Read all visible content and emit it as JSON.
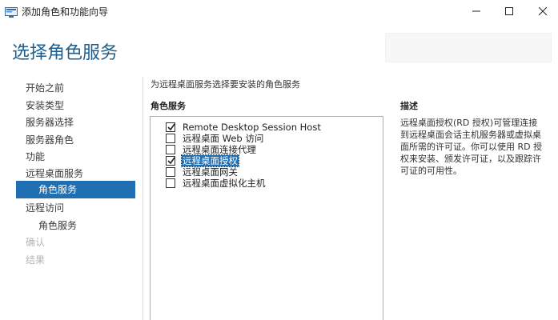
{
  "window": {
    "title": "添加角色和功能向导",
    "min_glyph": "—",
    "max_glyph": "☐",
    "close_glyph": "✕"
  },
  "header": {
    "page_title": "选择角色服务"
  },
  "nav": {
    "items": [
      {
        "label": "开始之前",
        "state": "normal"
      },
      {
        "label": "安装类型",
        "state": "normal"
      },
      {
        "label": "服务器选择",
        "state": "normal"
      },
      {
        "label": "服务器角色",
        "state": "normal"
      },
      {
        "label": "功能",
        "state": "normal"
      },
      {
        "label": "远程桌面服务",
        "state": "normal"
      },
      {
        "label": "角色服务",
        "state": "selected"
      },
      {
        "label": "远程访问",
        "state": "normal"
      },
      {
        "label": "角色服务",
        "state": "normal"
      },
      {
        "label": "确认",
        "state": "disabled"
      },
      {
        "label": "结果",
        "state": "disabled"
      }
    ]
  },
  "main": {
    "instruction": "为远程桌面服务选择要安装的角色服务",
    "roles_header": "角色服务",
    "roles": [
      {
        "label": "Remote Desktop Session Host",
        "checked": true,
        "selected": false
      },
      {
        "label": "远程桌面 Web 访问",
        "checked": false,
        "selected": false
      },
      {
        "label": "远程桌面连接代理",
        "checked": false,
        "selected": false
      },
      {
        "label": "远程桌面授权",
        "checked": true,
        "selected": true
      },
      {
        "label": "远程桌面网关",
        "checked": false,
        "selected": false
      },
      {
        "label": "远程桌面虚拟化主机",
        "checked": false,
        "selected": false
      }
    ],
    "description_header": "描述",
    "description": "远程桌面授权(RD 授权)可管理连接到远程桌面会话主机服务器或虚拟桌面所需的许可证。你可以使用 RD 授权来安装、颁发许可证，以及跟踪许可证的可用性。"
  },
  "colors": {
    "accent": "#1f6fb2",
    "title": "#1f5e8c"
  }
}
